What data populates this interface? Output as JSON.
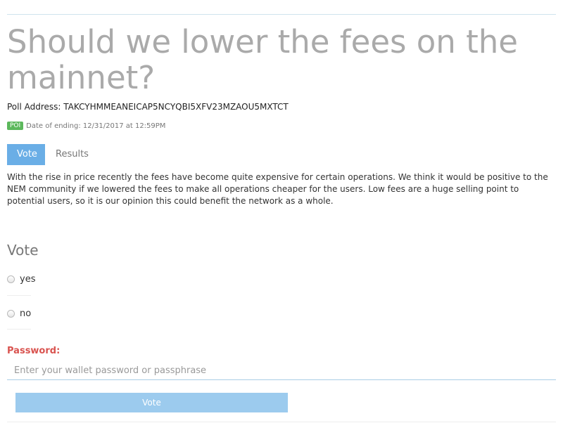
{
  "poll": {
    "title": "Should we lower the fees on the mainnet?",
    "address_label": "Poll Address: TAKCYHMMEANEICAP5NCYQBI5XFV23MZAOU5MXTCT",
    "badge": "POI",
    "ending": "Date of ending: 12/31/2017 at 12:59PM",
    "description": "With the rise in price recently the fees have become quite expensive for certain operations. We think it would be positive to the NEM community if we lowered the fees to make all operations cheaper for the users. Low fees are a huge selling point to potential users, so it is our opinion this could benefit the network as a whole."
  },
  "tabs": [
    {
      "label": "Vote",
      "active": true
    },
    {
      "label": "Results",
      "active": false
    }
  ],
  "vote": {
    "heading": "Vote",
    "options": [
      {
        "label": "yes",
        "selected": false
      },
      {
        "label": "no",
        "selected": false
      }
    ],
    "password_label": "Password:",
    "password_placeholder": "Enter your wallet password or passphrase",
    "password_value": "",
    "button_label": "Vote"
  },
  "colors": {
    "accent": "#6aaee6",
    "badge": "#5cb85c",
    "password_label": "#d9534f",
    "button": "#9ccbee"
  }
}
